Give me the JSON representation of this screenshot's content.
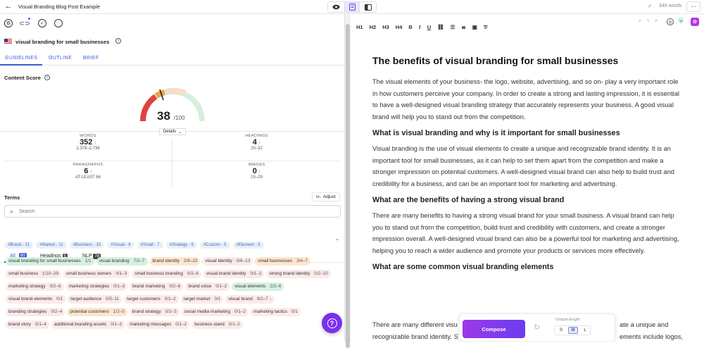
{
  "header": {
    "title": "Visual Branding Blog Post Example",
    "word_count": "349 words",
    "more": "···"
  },
  "keyword": {
    "text": "visual branding for small businesses",
    "flag": "us-flag-icon"
  },
  "tabs": [
    {
      "label": "GUIDELINES",
      "active": true
    },
    {
      "label": "OUTLINE",
      "active": false
    },
    {
      "label": "BRIEF",
      "active": false
    }
  ],
  "content_score": {
    "label": "Content Score",
    "score": "38",
    "max": "/100",
    "details": "Details",
    "value": 38
  },
  "stats": [
    {
      "label": "WORDS",
      "value": "352",
      "range": "2,379–2,736"
    },
    {
      "label": "HEADINGS",
      "value": "4",
      "range": "20–32"
    },
    {
      "label": "PARAGRAPHS",
      "value": "6",
      "range": "AT LEAST 64"
    },
    {
      "label": "IMAGES",
      "value": "0",
      "range": "15–29"
    }
  ],
  "terms": {
    "label": "Terms",
    "adjust": "Adjust",
    "search_placeholder": "Search",
    "chips": [
      "#Brand - 21",
      "#Market - 11",
      "#Business - 10",
      "#Visual - 8",
      "#Small - 7",
      "#Strategy - 6",
      "#Custom - 5",
      "#Element - 5"
    ],
    "filters": [
      {
        "label": "All",
        "count": "80"
      },
      {
        "label": "Headings",
        "count": "5"
      },
      {
        "label": "NLP",
        "count": "78"
      }
    ],
    "items": [
      {
        "t": "visual branding for small businesses",
        "c": "1/1",
        "s": "g"
      },
      {
        "t": "visual branding",
        "c": "7/2–7",
        "s": "g"
      },
      {
        "t": "brand identity",
        "c": "2/8–23",
        "s": "o"
      },
      {
        "t": "visual identity",
        "c": "0/6–13",
        "s": "r"
      },
      {
        "t": "small businesses",
        "c": "3/4–7",
        "s": "o"
      },
      {
        "t": "small business",
        "c": "1/10–29",
        "s": "r"
      },
      {
        "t": "small business owners",
        "c": "0/1–3",
        "s": "r"
      },
      {
        "t": "small business branding",
        "c": "0/2–6",
        "s": "r"
      },
      {
        "t": "visual brand identity",
        "c": "0/1–2",
        "s": "r"
      },
      {
        "t": "strong brand identity",
        "c": "0/2–10",
        "s": "r"
      },
      {
        "t": "marketing strategy",
        "c": "0/2–6",
        "s": "r"
      },
      {
        "t": "marketing strategies",
        "c": "0/1–3",
        "s": "r"
      },
      {
        "t": "brand marketing",
        "c": "0/2–6",
        "s": "r"
      },
      {
        "t": "brand voice",
        "c": "0/1–2",
        "s": "r"
      },
      {
        "t": "visual elements",
        "c": "2/2–6",
        "s": "g"
      },
      {
        "t": "visual brand elements",
        "c": "0/1",
        "s": "r"
      },
      {
        "t": "target audience",
        "c": "0/5–11",
        "s": "r"
      },
      {
        "t": "target customers",
        "c": "0/1–2",
        "s": "r"
      },
      {
        "t": "target market",
        "c": "0/1",
        "s": "r"
      },
      {
        "t": "visual brand",
        "c": "9/2–7 ↓",
        "s": "r"
      },
      {
        "t": "branding strategies",
        "c": "0/2–4",
        "s": "r"
      },
      {
        "t": "potential customers",
        "c": "1/2–5",
        "s": "o"
      },
      {
        "t": "brand strategy",
        "c": "0/2–3",
        "s": "r"
      },
      {
        "t": "social media marketing",
        "c": "0/1–2",
        "s": "r"
      },
      {
        "t": "marketing tactics",
        "c": "0/1",
        "s": "r"
      },
      {
        "t": "brand story",
        "c": "0/1–4",
        "s": "r"
      },
      {
        "t": "additional branding assets",
        "c": "0/1–2",
        "s": "r"
      },
      {
        "t": "marketing messages",
        "c": "0/1–2",
        "s": "r"
      },
      {
        "t": "business stand",
        "c": "0/1–2",
        "s": "r"
      }
    ]
  },
  "toolbar": [
    "H1",
    "H2",
    "H3",
    "H4",
    "B",
    "I",
    "U",
    "link",
    "ul",
    "ol",
    "img",
    "clear"
  ],
  "doc": {
    "h1": "The benefits of visual branding for small businesses",
    "p1": "The visual elements of your business- the logo, website, advertising, and so on- play a very important role in how customers perceive your company. In order to create a strong and lasting impression, it is essential to have a well-designed visual branding strategy that accurately represents your business. A good visual brand will help you to stand out from the competition.",
    "h2a": "What is visual branding and why is it important for small businesses",
    "p2": "Visual branding is the use of visual elements to create a unique and recognizable brand identity. It is an important tool for small businesses, as it can help to set them apart from the competition and make a stronger impression on potential customers. A well-designed visual brand can also help to build trust and credibility for a business, and can be an  important tool for marketing and advertising.",
    "h2b": "What are the benefits of having a strong visual brand",
    "p3": "There are many benefits to having a strong visual brand for your small business. A visual brand can help you to stand out from the competition, build trust and credibility with customers, and create a stronger impression overall. A well-designed  visual brand can also be a powerful tool for marketing and advertising, helping you to reach a wider audience and promote your products or services more effectively.",
    "h2c": "What are some common visual branding elements",
    "p4a": "There are many different visu",
    "p4b": "ate a unique and",
    "p4c": "recognizable brand identity. S",
    "p4d": "ements  include logos,"
  },
  "compose": {
    "label": "Compose",
    "output_length": "Output length",
    "sizes": [
      "S",
      "M",
      "L"
    ],
    "selected": "M"
  }
}
